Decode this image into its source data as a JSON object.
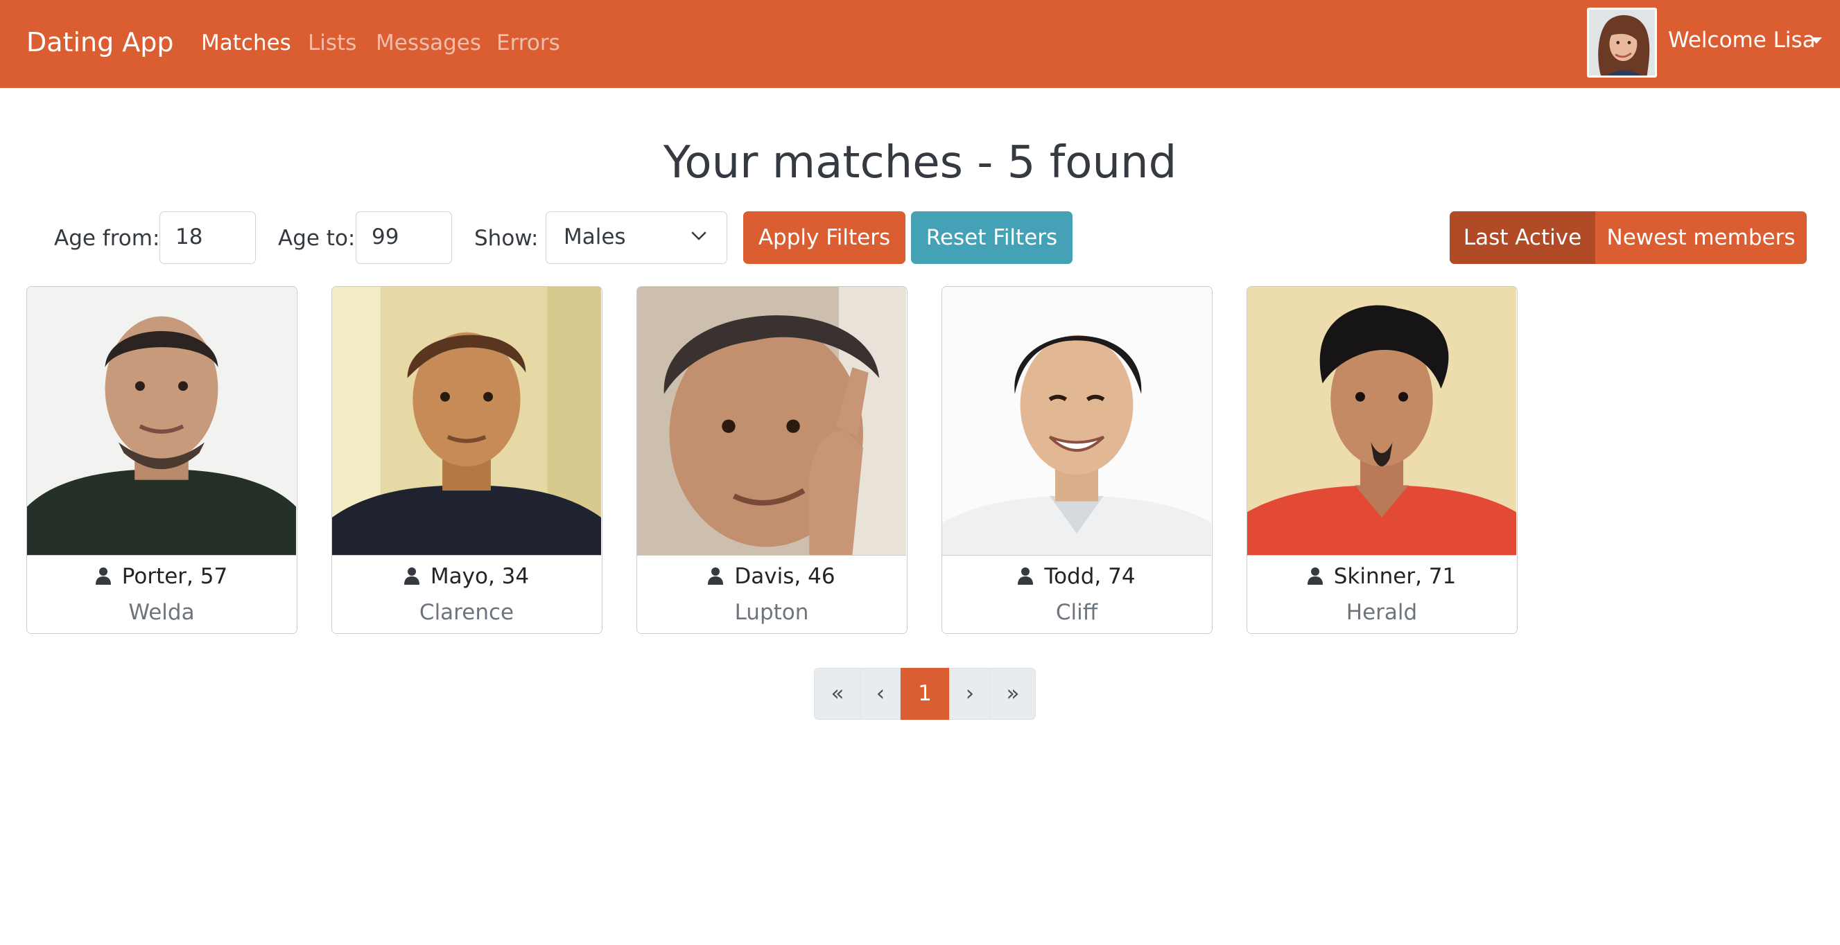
{
  "navbar": {
    "brand": "Dating App",
    "links": [
      "Matches",
      "Lists",
      "Messages",
      "Errors"
    ],
    "active_link": "Matches",
    "welcome": "Welcome Lisa"
  },
  "page": {
    "title": "Your matches - 5 found"
  },
  "filters": {
    "age_from_label": "Age from:",
    "age_from_value": "18",
    "age_to_label": "Age to:",
    "age_to_value": "99",
    "show_label": "Show:",
    "show_value": "Males",
    "apply_label": "Apply Filters",
    "reset_label": "Reset Filters",
    "sort_last_active": "Last Active",
    "sort_newest": "Newest members",
    "active_sort": "Last Active"
  },
  "members": [
    {
      "name": "Porter, 57",
      "city": "Welda"
    },
    {
      "name": "Mayo, 34",
      "city": "Clarence"
    },
    {
      "name": "Davis, 46",
      "city": "Lupton"
    },
    {
      "name": "Todd, 74",
      "city": "Cliff"
    },
    {
      "name": "Skinner, 71",
      "city": "Herald"
    }
  ],
  "pagination": {
    "first": "«",
    "prev": "‹",
    "current": "1",
    "next": "›",
    "last": "»"
  },
  "colors": {
    "primary": "#db5e33",
    "primary_dark": "#b04a27",
    "info": "#45a1b5"
  },
  "icons": {
    "member": "user-icon",
    "select": "chevron-down-icon",
    "menu": "caret-down-icon"
  }
}
